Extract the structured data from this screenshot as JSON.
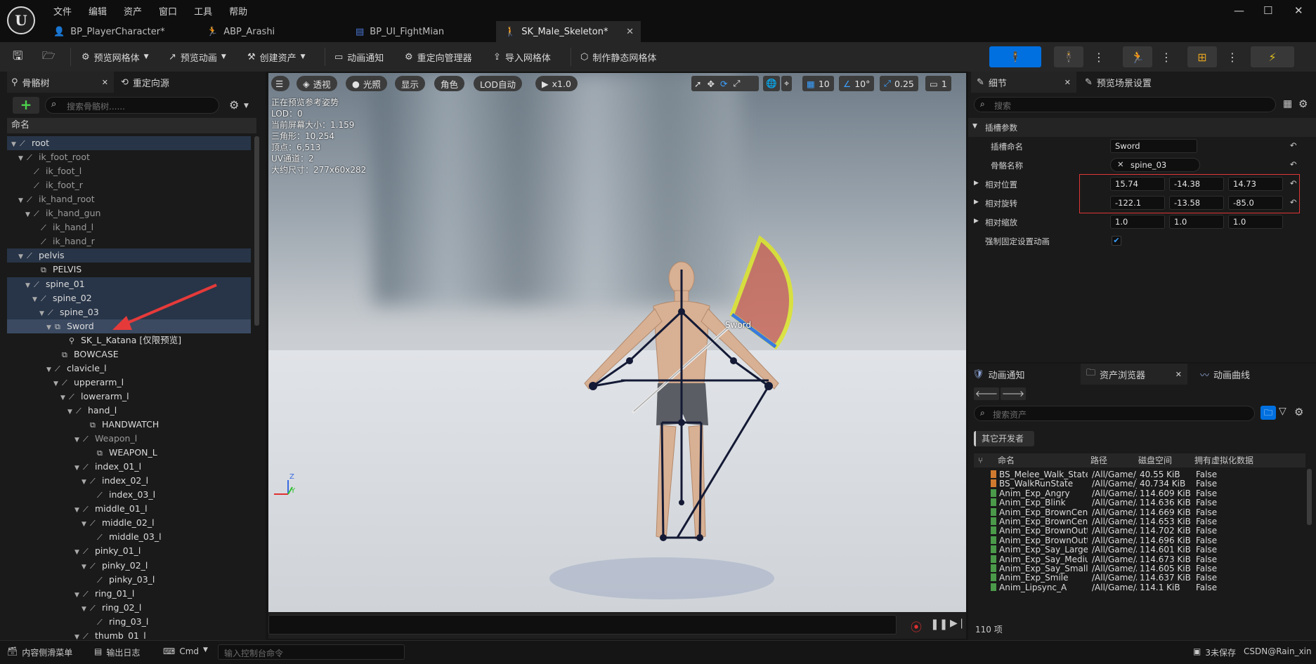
{
  "menu": [
    "文件",
    "编辑",
    "资产",
    "窗口",
    "工具",
    "帮助"
  ],
  "logo": "U",
  "tabs": [
    {
      "label": "BP_PlayerCharacter*",
      "icon": "person-icon",
      "color": "#4a78d8"
    },
    {
      "label": "ABP_Arashi",
      "icon": "anim-blueprint-icon",
      "color": "#d8a040"
    },
    {
      "label": "BP_UI_FightMian",
      "icon": "widget-icon",
      "color": "#4a78d8"
    },
    {
      "label": "SK_Male_Skeleton*",
      "icon": "skeleton-icon",
      "color": "#9ab0d0"
    }
  ],
  "window_buttons": [
    "—",
    "☐",
    "✕"
  ],
  "toolbar": {
    "preview_mesh": "预览网格体",
    "preview_anim": "预览动画",
    "create_asset": "创建资产",
    "anim_notify": "动画通知",
    "retarget_manager": "重定向管理器",
    "import_mesh": "导入网格体",
    "make_static_mesh": "制作静态网格体"
  },
  "accent": "#0070e0",
  "left_panel": {
    "tab1": "骨骼树",
    "tab2": "重定向源",
    "search_placeholder": "搜索骨骼树......",
    "add": "+",
    "column": "命名",
    "bones": [
      {
        "name": "root",
        "indent": 0,
        "hl": true,
        "tri": "▼"
      },
      {
        "name": "ik_foot_root",
        "indent": 1,
        "dim": true,
        "tri": "▼"
      },
      {
        "name": "ik_foot_l",
        "indent": 2,
        "dim": true
      },
      {
        "name": "ik_foot_r",
        "indent": 2,
        "dim": true
      },
      {
        "name": "ik_hand_root",
        "indent": 1,
        "dim": true,
        "tri": "▼"
      },
      {
        "name": "ik_hand_gun",
        "indent": 2,
        "dim": true,
        "tri": "▼"
      },
      {
        "name": "ik_hand_l",
        "indent": 3,
        "dim": true
      },
      {
        "name": "ik_hand_r",
        "indent": 3,
        "dim": true
      },
      {
        "name": "pelvis",
        "indent": 1,
        "hl": true,
        "tri": "▼"
      },
      {
        "name": "PELVIS",
        "indent": 3,
        "socket": true
      },
      {
        "name": "spine_01",
        "indent": 2,
        "hl": true,
        "tri": "▼"
      },
      {
        "name": "spine_02",
        "indent": 3,
        "hl": true,
        "tri": "▼"
      },
      {
        "name": "spine_03",
        "indent": 4,
        "hl": true,
        "tri": "▼"
      },
      {
        "name": "Sword",
        "indent": 5,
        "sel": true,
        "socket": true,
        "tri": "▼"
      },
      {
        "name": "SK_L_Katana",
        "suffix": "[仅限预览]",
        "indent": 7,
        "mesh": true
      },
      {
        "name": "BOWCASE",
        "indent": 6,
        "socket": true
      },
      {
        "name": "clavicle_l",
        "indent": 5,
        "tri": "▼"
      },
      {
        "name": "upperarm_l",
        "indent": 6,
        "tri": "▼"
      },
      {
        "name": "lowerarm_l",
        "indent": 7,
        "tri": "▼"
      },
      {
        "name": "hand_l",
        "indent": 8,
        "tri": "▼"
      },
      {
        "name": "HANDWATCH",
        "indent": 10,
        "socket": true
      },
      {
        "name": "Weapon_l",
        "indent": 9,
        "dim": true,
        "tri": "▼"
      },
      {
        "name": "WEAPON_L",
        "indent": 11,
        "socket": true
      },
      {
        "name": "index_01_l",
        "indent": 9,
        "tri": "▼"
      },
      {
        "name": "index_02_l",
        "indent": 10,
        "tri": "▼"
      },
      {
        "name": "index_03_l",
        "indent": 11
      },
      {
        "name": "middle_01_l",
        "indent": 9,
        "tri": "▼"
      },
      {
        "name": "middle_02_l",
        "indent": 10,
        "tri": "▼"
      },
      {
        "name": "middle_03_l",
        "indent": 11
      },
      {
        "name": "pinky_01_l",
        "indent": 9,
        "tri": "▼"
      },
      {
        "name": "pinky_02_l",
        "indent": 10,
        "tri": "▼"
      },
      {
        "name": "pinky_03_l",
        "indent": 11
      },
      {
        "name": "ring_01_l",
        "indent": 9,
        "tri": "▼"
      },
      {
        "name": "ring_02_l",
        "indent": 10,
        "tri": "▼"
      },
      {
        "name": "ring_03_l",
        "indent": 11
      },
      {
        "name": "thumb_01_l",
        "indent": 9,
        "tri": "▼"
      }
    ]
  },
  "viewport": {
    "perspective": "透视",
    "lit": "光照",
    "show": "显示",
    "character": "角色",
    "lod": "LOD自动",
    "speed": "x1.0",
    "grid_snap": "10",
    "rot_snap": "10°",
    "scale_snap": "0.25",
    "camera_speed": "1",
    "info": [
      "正在预览参考姿势",
      "LOD：0",
      "当前屏幕大小：1.159",
      "三角形：10,254",
      "顶点：6,513",
      "UV通道：2",
      "大约尺寸：277x60x282"
    ],
    "socket_label": "Sword",
    "axis": [
      "Z",
      "Y"
    ]
  },
  "details": {
    "tab1": "细节",
    "tab2": "预览场景设置",
    "search_placeholder": "搜索",
    "section": "插槽参数",
    "socket_name_label": "插槽命名",
    "socket_name": "Sword",
    "bone_name_label": "骨骼名称",
    "bone_name": "spine_03",
    "rel_loc_label": "相对位置",
    "rel_loc": [
      "15.74",
      "-14.38",
      "14.73"
    ],
    "rel_rot_label": "相对旋转",
    "rel_rot": [
      "-122.1",
      "-13.58",
      "-85.0"
    ],
    "rel_scale_label": "相对缩放",
    "rel_scale": [
      "1.0",
      "1.0",
      "1.0"
    ],
    "force_anim_label": "强制固定设置动画",
    "highlight_color": "#e03434"
  },
  "content": {
    "tab1": "动画通知",
    "tab2": "资产浏览器",
    "tab3": "动画曲线",
    "search_placeholder": "搜索资产",
    "filter_chip": "其它开发者",
    "headers": [
      "命名",
      "路径",
      "磁盘空间",
      "拥有虚拟化数据"
    ],
    "rows": [
      {
        "name": "BS_Melee_Walk_State",
        "path": "/All/Game/_(",
        "size": "40.55 KiB",
        "virt": "False",
        "type": "orange"
      },
      {
        "name": "BS_WalkRunState",
        "path": "/All/Game/_(",
        "size": "40.734 KiB",
        "virt": "False",
        "type": "orange"
      },
      {
        "name": "Anim_Exp_Angry",
        "path": "/All/Game/Ai",
        "size": "114.609 KiB",
        "virt": "False",
        "type": "green"
      },
      {
        "name": "Anim_Exp_Blink",
        "path": "/All/Game/Ai",
        "size": "114.636 KiB",
        "virt": "False",
        "type": "green"
      },
      {
        "name": "Anim_Exp_BrownCente",
        "path": "/All/Game/Ai",
        "size": "114.669 KiB",
        "virt": "False",
        "type": "green"
      },
      {
        "name": "Anim_Exp_BrownCente",
        "path": "/All/Game/Ai",
        "size": "114.653 KiB",
        "virt": "False",
        "type": "green"
      },
      {
        "name": "Anim_Exp_BrownOutte",
        "path": "/All/Game/Ai",
        "size": "114.702 KiB",
        "virt": "False",
        "type": "green"
      },
      {
        "name": "Anim_Exp_BrownOutte",
        "path": "/All/Game/Ai",
        "size": "114.696 KiB",
        "virt": "False",
        "type": "green"
      },
      {
        "name": "Anim_Exp_Say_Large",
        "path": "/All/Game/Ai",
        "size": "114.601 KiB",
        "virt": "False",
        "type": "green"
      },
      {
        "name": "Anim_Exp_Say_Mediur",
        "path": "/All/Game/Ai",
        "size": "114.673 KiB",
        "virt": "False",
        "type": "green"
      },
      {
        "name": "Anim_Exp_Say_Small",
        "path": "/All/Game/Ai",
        "size": "114.605 KiB",
        "virt": "False",
        "type": "green"
      },
      {
        "name": "Anim_Exp_Smile",
        "path": "/All/Game/Ai",
        "size": "114.637 KiB",
        "virt": "False",
        "type": "green"
      },
      {
        "name": "Anim_Lipsync_A",
        "path": "/All/Game/Ai",
        "size": "114.1 KiB",
        "virt": "False",
        "type": "green"
      }
    ],
    "count": "110 项"
  },
  "statusbar": {
    "content_drawer": "内容侧滑菜单",
    "output_log": "输出日志",
    "cmd": "Cmd",
    "console_placeholder": "输入控制台命令",
    "unsaved": "3未保存",
    "source_control": "CSDN@Rain_xin"
  }
}
